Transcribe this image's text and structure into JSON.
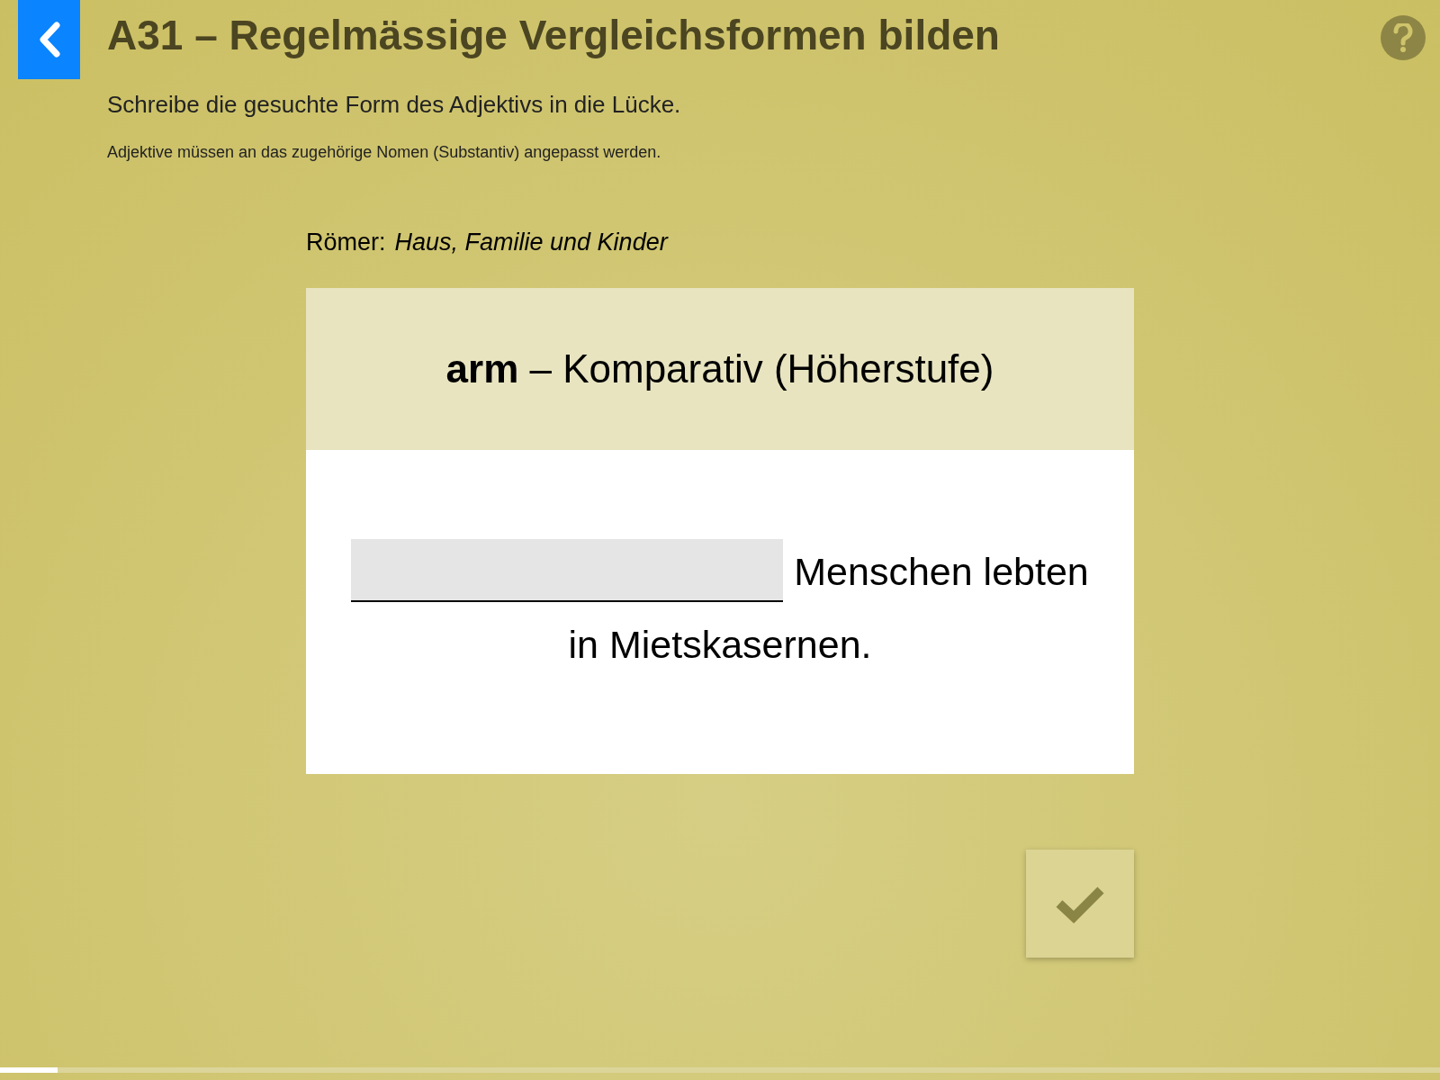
{
  "header": {
    "title": "A31 – Regelmässige Vergleichsformen bilden",
    "instruction": "Schreibe die gesuchte Form des Adjektivs in die Lücke.",
    "note": "Adjektive müssen an das zugehörige Nomen (Substantiv) angepasst werden."
  },
  "topic": {
    "label": "Römer:",
    "value": "Haus, Familie und Kinder"
  },
  "card": {
    "prompt": "**arm** – Komparativ (Höherstufe)",
    "sentence_rest": "Menschen lebten in Mietskasernen."
  },
  "progress": {
    "level": 0.04
  }
}
